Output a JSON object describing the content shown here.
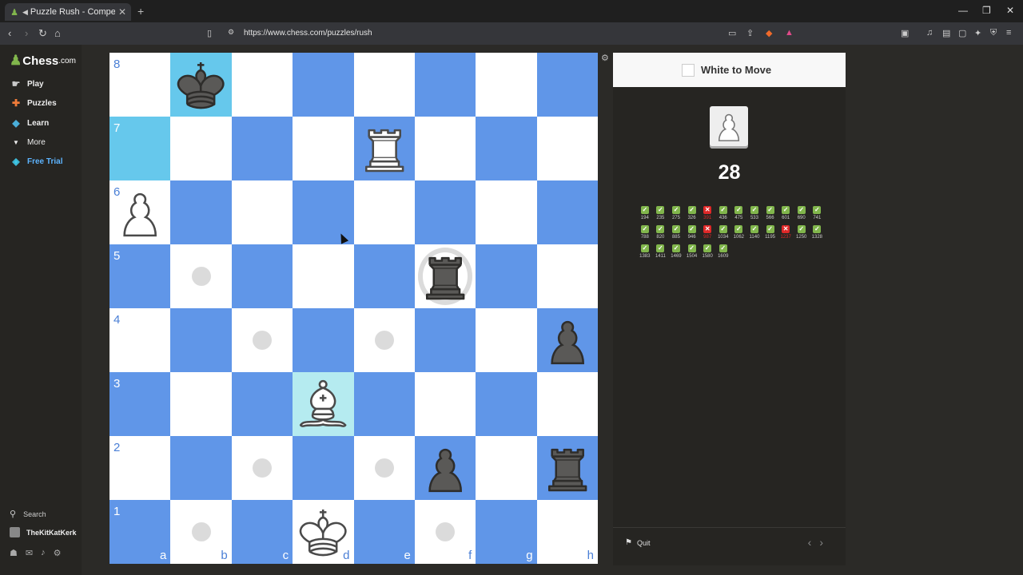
{
  "browser": {
    "tab_title": "Puzzle Rush - Compete to So",
    "url": "https://www.chess.com/puzzles/rush"
  },
  "sidebar": {
    "logo": "Chess",
    "logo_suffix": ".com",
    "items": [
      {
        "label": "Play",
        "icon": "play-hand-icon"
      },
      {
        "label": "Puzzles",
        "icon": "puzzle-icon"
      },
      {
        "label": "Learn",
        "icon": "graduation-cap-icon"
      },
      {
        "label": "More",
        "icon": "chevron-down-icon"
      },
      {
        "label": "Free Trial",
        "icon": "diamond-icon"
      }
    ],
    "search_label": "Search",
    "username": "TheKitKatKerk"
  },
  "board": {
    "rank_labels": [
      "8",
      "7",
      "6",
      "5",
      "4",
      "3",
      "2",
      "1"
    ],
    "file_labels": [
      "a",
      "b",
      "c",
      "d",
      "e",
      "f",
      "g",
      "h"
    ],
    "highlight_squares": [
      "b8",
      "a7"
    ],
    "selected_square": "d3",
    "move_hint_squares": [
      "b5",
      "c4",
      "e4",
      "c2",
      "e2",
      "b1",
      "f1"
    ],
    "capture_hint_squares": [
      "f5"
    ],
    "pieces": [
      {
        "square": "b8",
        "piece": "black-king"
      },
      {
        "square": "e7",
        "piece": "white-rook"
      },
      {
        "square": "a6",
        "piece": "white-pawn"
      },
      {
        "square": "f5",
        "piece": "black-rook"
      },
      {
        "square": "h4",
        "piece": "black-pawn"
      },
      {
        "square": "d3",
        "piece": "white-bishop"
      },
      {
        "square": "f2",
        "piece": "black-pawn"
      },
      {
        "square": "h2",
        "piece": "black-rook"
      },
      {
        "square": "d1",
        "piece": "white-king"
      }
    ]
  },
  "panel": {
    "title": "White to Move",
    "score": "28",
    "results": [
      {
        "rating": "194",
        "ok": true
      },
      {
        "rating": "235",
        "ok": true
      },
      {
        "rating": "275",
        "ok": true
      },
      {
        "rating": "326",
        "ok": true
      },
      {
        "rating": "391",
        "ok": false
      },
      {
        "rating": "436",
        "ok": true
      },
      {
        "rating": "475",
        "ok": true
      },
      {
        "rating": "533",
        "ok": true
      },
      {
        "rating": "566",
        "ok": true
      },
      {
        "rating": "601",
        "ok": true
      },
      {
        "rating": "690",
        "ok": true
      },
      {
        "rating": "741",
        "ok": true
      },
      {
        "rating": "788",
        "ok": true
      },
      {
        "rating": "820",
        "ok": true
      },
      {
        "rating": "885",
        "ok": true
      },
      {
        "rating": "946",
        "ok": true
      },
      {
        "rating": "987",
        "ok": false
      },
      {
        "rating": "1034",
        "ok": true
      },
      {
        "rating": "1062",
        "ok": true
      },
      {
        "rating": "1140",
        "ok": true
      },
      {
        "rating": "1195",
        "ok": true
      },
      {
        "rating": "1237",
        "ok": false
      },
      {
        "rating": "1250",
        "ok": true
      },
      {
        "rating": "1328",
        "ok": true
      },
      {
        "rating": "1383",
        "ok": true
      },
      {
        "rating": "1411",
        "ok": true
      },
      {
        "rating": "1469",
        "ok": true
      },
      {
        "rating": "1504",
        "ok": true
      },
      {
        "rating": "1580",
        "ok": true
      },
      {
        "rating": "1609",
        "ok": true
      }
    ],
    "quit_label": "Quit"
  },
  "colors": {
    "light_square": "#ffffff",
    "dark_square": "#6096e8",
    "highlight": "#66c8ec",
    "selected": "#b5ebf0",
    "ok": "#81b64c",
    "bad": "#e02828"
  }
}
